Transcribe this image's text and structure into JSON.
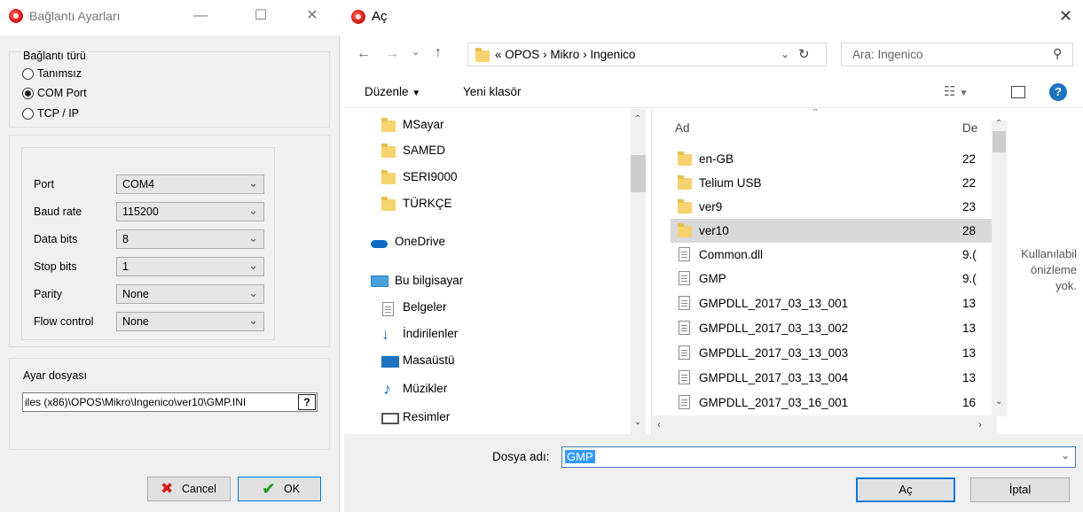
{
  "connection_dialog": {
    "title": "Bağlantı Ayarları",
    "connection_type": {
      "label": "Bağlantı türü",
      "options": [
        "Tanımsız",
        "COM Port",
        "TCP / IP"
      ],
      "selected": "COM Port"
    },
    "serial": {
      "port": {
        "label": "Port",
        "value": "COM4"
      },
      "baud_rate": {
        "label": "Baud rate",
        "value": "115200"
      },
      "data_bits": {
        "label": "Data bits",
        "value": "8"
      },
      "stop_bits": {
        "label": "Stop bits",
        "value": "1"
      },
      "parity": {
        "label": "Parity",
        "value": "None"
      },
      "flow_control": {
        "label": "Flow control",
        "value": "None"
      }
    },
    "settings_file": {
      "label": "Ayar dosyası",
      "value": "iles (x86)\\OPOS\\Mikro\\Ingenico\\ver10\\GMP.INI",
      "browse_label": "?"
    },
    "cancel_label": "Cancel",
    "ok_label": "OK"
  },
  "open_dialog": {
    "title": "Aç",
    "address": {
      "overflow": "«",
      "crumbs": [
        "OPOS",
        "Mikro",
        "Ingenico"
      ]
    },
    "search_placeholder": "Ara: Ingenico",
    "commands": {
      "organize": "Düzenle",
      "new_folder": "Yeni klasör"
    },
    "nav_pane": [
      {
        "label": "MSayar",
        "icon": "folder-icon"
      },
      {
        "label": "SAMED",
        "icon": "folder-icon"
      },
      {
        "label": "SERI9000",
        "icon": "folder-icon"
      },
      {
        "label": "TÜRKÇE",
        "icon": "folder-icon"
      },
      {
        "label": "OneDrive",
        "icon": "cloud-icon"
      },
      {
        "label": "Bu bilgisayar",
        "icon": "computer-icon"
      },
      {
        "label": "Belgeler",
        "icon": "documents-icon"
      },
      {
        "label": "İndirilenler",
        "icon": "download-icon"
      },
      {
        "label": "Masaüstü",
        "icon": "desktop-icon"
      },
      {
        "label": "Müzikler",
        "icon": "music-icon"
      },
      {
        "label": "Resimler",
        "icon": "pictures-icon"
      }
    ],
    "columns": {
      "name": "Ad",
      "date": "De"
    },
    "files": [
      {
        "name": "en-GB",
        "date": "22",
        "icon": "folder-icon"
      },
      {
        "name": "Telium USB",
        "date": "22",
        "icon": "folder-icon"
      },
      {
        "name": "ver9",
        "date": "23",
        "icon": "folder-icon"
      },
      {
        "name": "ver10",
        "date": "28",
        "icon": "folder-icon",
        "selected": true
      },
      {
        "name": "Common.dll",
        "date": "9.(",
        "icon": "dll-icon"
      },
      {
        "name": "GMP",
        "date": "9.(",
        "icon": "settings-file-icon"
      },
      {
        "name": "GMPDLL_2017_03_13_001",
        "date": "13",
        "icon": "text-file-icon"
      },
      {
        "name": "GMPDLL_2017_03_13_002",
        "date": "13",
        "icon": "text-file-icon"
      },
      {
        "name": "GMPDLL_2017_03_13_003",
        "date": "13",
        "icon": "text-file-icon"
      },
      {
        "name": "GMPDLL_2017_03_13_004",
        "date": "13",
        "icon": "text-file-icon"
      },
      {
        "name": "GMPDLL_2017_03_16_001",
        "date": "16",
        "icon": "text-file-icon"
      }
    ],
    "preview": {
      "line1": "Kullanılabil",
      "line2": "önizleme",
      "line3": "yok."
    },
    "filename": {
      "label": "Dosya adı:",
      "value": "GMP"
    },
    "open_label": "Aç",
    "cancel_label": "İptal"
  },
  "colors": {
    "accent": "#0078d7",
    "help": "#1e73be"
  }
}
